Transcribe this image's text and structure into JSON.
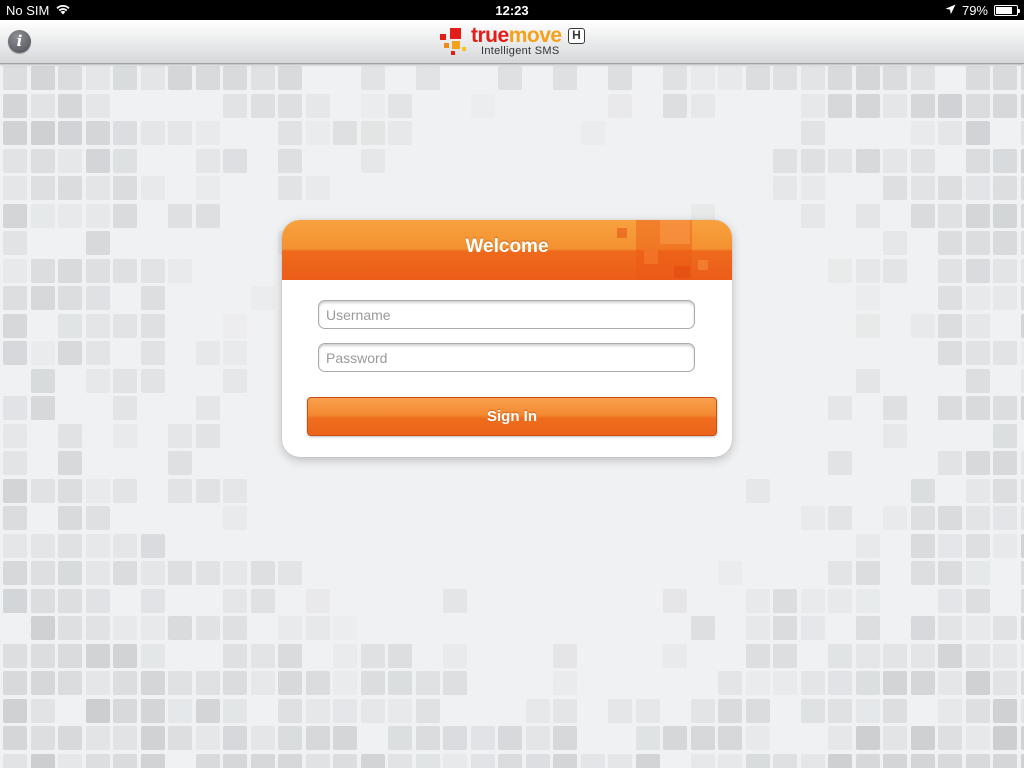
{
  "status_bar": {
    "carrier": "No SIM",
    "time": "12:23",
    "battery_percent": "79%",
    "battery_level": 0.79,
    "icons": [
      "wifi-icon",
      "location-arrow-icon",
      "battery-icon"
    ]
  },
  "nav_bar": {
    "info_icon": "info-icon",
    "brand": {
      "word_true": "true",
      "word_move": "move",
      "badge": "H",
      "subtitle": "Intelligent SMS"
    }
  },
  "login": {
    "title": "Welcome",
    "username_placeholder": "Username",
    "username_value": "",
    "password_placeholder": "Password",
    "password_value": "",
    "sign_in_label": "Sign In"
  },
  "colors": {
    "accent_orange": "#f48a32",
    "brand_red": "#e31d1a",
    "brand_yellow": "#f4a11c",
    "background": "#f0f1f2"
  }
}
